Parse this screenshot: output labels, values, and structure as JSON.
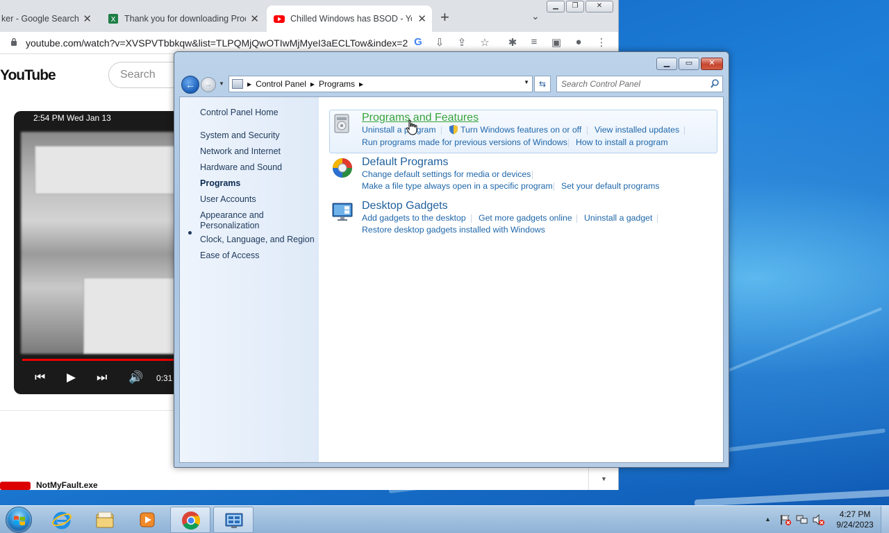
{
  "browser": {
    "tabs": [
      {
        "title": "ker - Google Search",
        "icon": "google-icon"
      },
      {
        "title": "Thank you for downloading Proc",
        "icon": "sheets-icon"
      },
      {
        "title": "Chilled Windows has BSOD - You",
        "icon": "youtube-icon",
        "active": true
      }
    ],
    "url": "youtube.com/watch?v=XVSPVTbbkqw&list=TLPQMjQwOTIwMjMyeI3aECLTow&index=2",
    "youtube": {
      "logo": "YouTube",
      "search_placeholder": "Search",
      "video_overlay_time": "2:54 PM   Wed Jan 13",
      "player_time": "0:31",
      "next_video": "NotMyFault.exe"
    }
  },
  "control_panel": {
    "address": {
      "crumbs": [
        "Control Panel",
        "Programs"
      ]
    },
    "search_placeholder": "Search Control Panel",
    "nav": {
      "home": "Control Panel Home",
      "items": [
        {
          "label": "System and Security"
        },
        {
          "label": "Network and Internet"
        },
        {
          "label": "Hardware and Sound"
        },
        {
          "label": "Programs",
          "current": true
        },
        {
          "label": "User Accounts"
        },
        {
          "label": "Appearance and\nPersonalization"
        },
        {
          "label": "Clock, Language, and Region"
        },
        {
          "label": "Ease of Access"
        }
      ]
    },
    "categories": [
      {
        "title": "Programs and Features",
        "icon": "programs-features-icon",
        "tasks": [
          "Uninstall a program",
          "Turn Windows features on or off",
          "View installed updates",
          "Run programs made for previous versions of Windows",
          "How to install a program"
        ]
      },
      {
        "title": "Default Programs",
        "icon": "default-programs-icon",
        "tasks": [
          "Change default settings for media or devices",
          "Make a file type always open in a specific program",
          "Set your default programs"
        ]
      },
      {
        "title": "Desktop Gadgets",
        "icon": "desktop-gadgets-icon",
        "tasks": [
          "Add gadgets to the desktop",
          "Get more gadgets online",
          "Uninstall a gadget",
          "Restore desktop gadgets installed with Windows"
        ]
      }
    ]
  },
  "taskbar": {
    "apps": [
      "internet-explorer-icon",
      "file-explorer-icon",
      "media-player-icon",
      "chrome-icon",
      "control-panel-icon"
    ],
    "clock_time": "4:27 PM",
    "clock_date": "9/24/2023"
  }
}
